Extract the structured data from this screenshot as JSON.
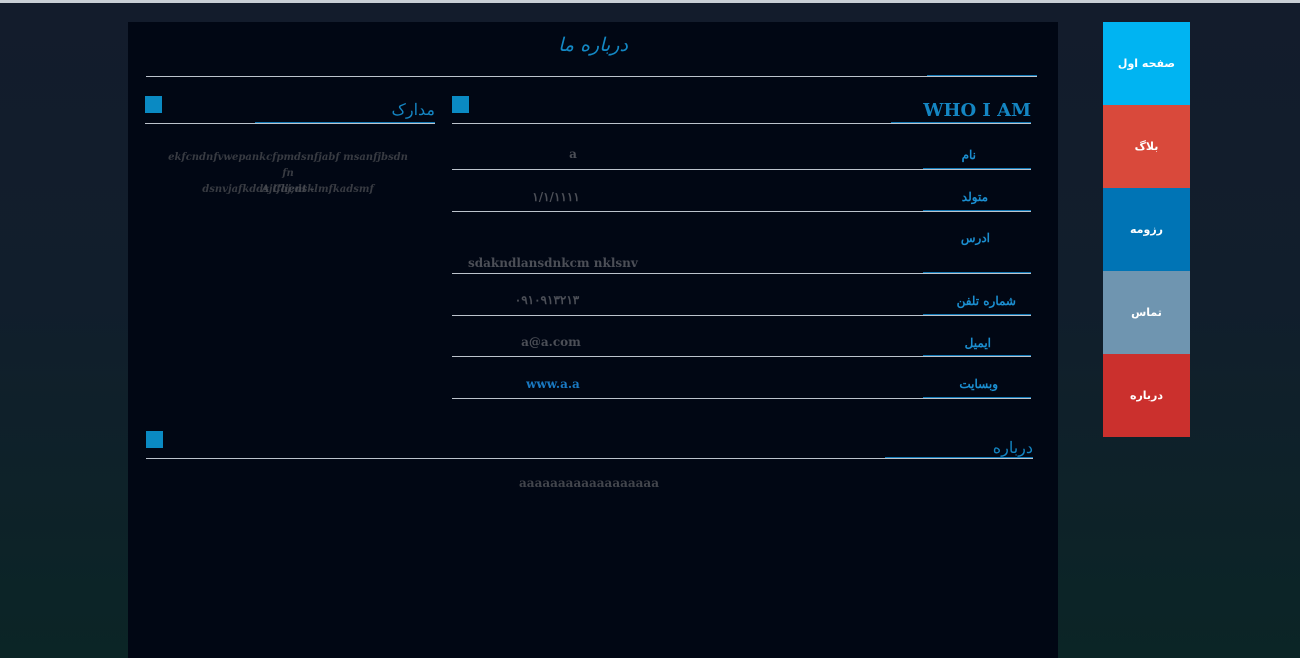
{
  "colors": {
    "accent": "#0a8ac3",
    "panel_background": "#010714",
    "nav_home": "#00b4f2",
    "nav_blog": "#d9493b",
    "nav_resume": "#0074b5",
    "nav_contact": "#6f95b0",
    "nav_about": "#cb302d"
  },
  "header": {
    "title": "درباره ما"
  },
  "who_section": {
    "title": "WHO I AM",
    "fields": [
      {
        "label": "نام",
        "value": "a"
      },
      {
        "label": "متولد",
        "value": "۱/۱/۱۱۱۱"
      },
      {
        "label": "ادرس",
        "value": "sdakndlansdnkcm nklsnv"
      },
      {
        "label": "شماره تلفن",
        "value": "۰۹۱۰۹۱۳۲۱۳"
      },
      {
        "label": "ایمیل",
        "value": "a@a.com"
      },
      {
        "label": "وبسایت",
        "value": "www.a.a"
      }
    ]
  },
  "certificates": {
    "title": "مدارک",
    "line1": "ekfcndnfvwepankcfpmdsnfjabf msanfjbsdn fn",
    "line2": "dsnvjafkddsjifoj;dsklmfkadsmf",
    "author": "A Client -"
  },
  "about": {
    "title": "درباره",
    "text": "aaaaaaaaaaaaaaaaaa"
  },
  "nav": {
    "items": [
      {
        "label": "صفحه اول",
        "icon": "home"
      },
      {
        "label": "بلاگ",
        "icon": "blog"
      },
      {
        "label": "رزومه",
        "icon": "resume"
      },
      {
        "label": "تماس",
        "icon": "contact"
      },
      {
        "label": "درباره",
        "icon": "about"
      }
    ]
  }
}
